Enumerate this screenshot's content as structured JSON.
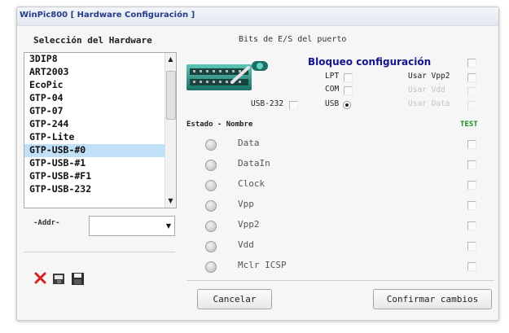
{
  "window": {
    "title": "WinPic800 [ Hardware Configuración ]"
  },
  "left": {
    "section_title": "Selección del Hardware",
    "hardware_list": [
      {
        "label": "3DIP8",
        "selected": false
      },
      {
        "label": "ART2003",
        "selected": false
      },
      {
        "label": "EcoPic",
        "selected": false
      },
      {
        "label": "GTP-04",
        "selected": false
      },
      {
        "label": "GTP-07",
        "selected": false
      },
      {
        "label": "GTP-244",
        "selected": false
      },
      {
        "label": "GTP-Lite",
        "selected": false
      },
      {
        "label": "GTP-USB-#0",
        "selected": true
      },
      {
        "label": "GTP-USB-#1",
        "selected": false
      },
      {
        "label": "GTP-USB-#F1",
        "selected": false
      },
      {
        "label": "GTP-USB-232",
        "selected": false
      }
    ],
    "addr_label": "-Addr-",
    "addr_value": ""
  },
  "right": {
    "section_title": "Bits de E/S del puerto",
    "lock_title": "Bloqueo configuración",
    "ports": {
      "lpt": "LPT",
      "com": "COM",
      "usb232": "USB-232",
      "usb": "USB",
      "selected": "USB"
    },
    "options": [
      {
        "label": "Usar Vpp2",
        "enabled": true
      },
      {
        "label": "Usar Vdd",
        "enabled": false
      },
      {
        "label": "Usar Data",
        "enabled": false
      }
    ],
    "signal_header": "Estado - Nombre",
    "test_header": "TEST",
    "signals": [
      {
        "label": "Data"
      },
      {
        "label": "DataIn"
      },
      {
        "label": "Clock"
      },
      {
        "label": "Vpp"
      },
      {
        "label": "Vpp2"
      },
      {
        "label": "Vdd"
      },
      {
        "label": "Mclr ICSP"
      }
    ]
  },
  "buttons": {
    "cancel": "Cancelar",
    "confirm": "Confirmar cambios"
  },
  "colors": {
    "title": "#233c88",
    "lock_title": "#14148c",
    "test": "#1a8f1a",
    "selection": "#bfe0f7",
    "delete_icon": "#d81e1e"
  },
  "icons": {
    "delete": "red-x-icon",
    "open": "open-icon",
    "save": "save-icon"
  }
}
